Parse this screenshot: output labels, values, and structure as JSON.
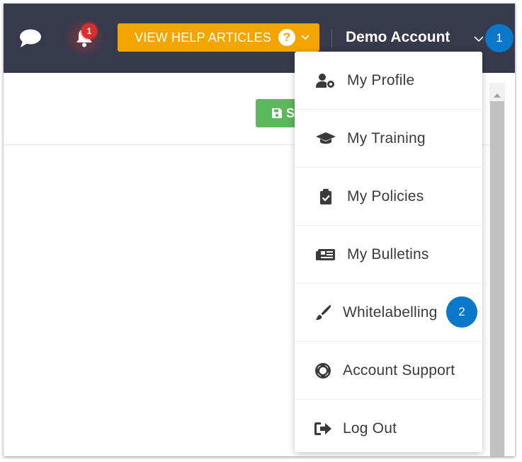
{
  "header": {
    "notification_count": "1",
    "help_button_label": "VIEW HELP ARTICLES",
    "help_icon_glyph": "?",
    "account_name": "Demo Account",
    "colors": {
      "topbar": "#373a4d",
      "help": "#f5a500",
      "badge_red": "#d92e2e",
      "step_blue": "#0b77c9",
      "save_green": "#5cb85c"
    }
  },
  "toolbar": {
    "save_label": "S"
  },
  "callouts": {
    "step1": "1",
    "step2": "2"
  },
  "menu": {
    "items": [
      {
        "label": "My Profile",
        "icon": "user-cog-icon"
      },
      {
        "label": "My Training",
        "icon": "graduation-cap-icon"
      },
      {
        "label": "My Policies",
        "icon": "clipboard-check-icon"
      },
      {
        "label": "My Bulletins",
        "icon": "newspaper-icon"
      },
      {
        "label": "Whitelabelling",
        "icon": "paintbrush-icon"
      },
      {
        "label": "Account Support",
        "icon": "life-ring-icon"
      },
      {
        "label": "Log Out",
        "icon": "sign-out-icon"
      }
    ]
  }
}
